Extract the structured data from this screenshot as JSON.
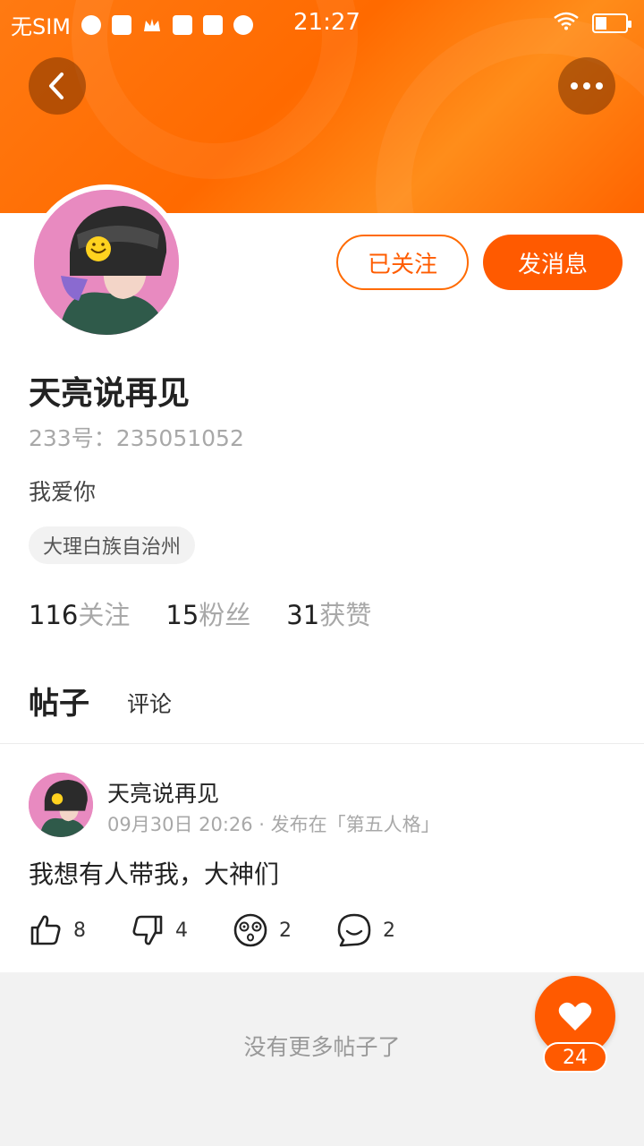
{
  "status_bar": {
    "carrier": "无SIM",
    "time": "21:27",
    "icons": [
      "browser-icon",
      "shop-icon",
      "crown-icon",
      "bag-icon",
      "mail-icon",
      "video-icon"
    ]
  },
  "header": {
    "back_icon": "chevron-left-icon",
    "more_icon": "more-dots-icon",
    "accent_color": "#ff6a00"
  },
  "profile": {
    "follow_label": "已关注",
    "message_label": "发消息",
    "name": "天亮说再见",
    "uid": "233号：235051052",
    "bio": "我爱你",
    "location": "大理白族自治州",
    "stats": [
      {
        "num": "116",
        "label": "关注"
      },
      {
        "num": "15",
        "label": "粉丝"
      },
      {
        "num": "31",
        "label": "获赞"
      }
    ]
  },
  "tabs": {
    "active": "帖子",
    "other": "评论"
  },
  "post": {
    "author": "天亮说再见",
    "meta": "09月30日 20:26 · 发布在「第五人格」",
    "text": "我想有人带我，大神们",
    "actions": [
      {
        "icon": "thumbs-up-icon",
        "count": "8"
      },
      {
        "icon": "thumbs-down-icon",
        "count": "4"
      },
      {
        "icon": "dizzy-face-icon",
        "count": "2"
      },
      {
        "icon": "comment-icon",
        "count": "2"
      }
    ]
  },
  "footer": {
    "no_more": "没有更多帖子了",
    "like_count": "24"
  }
}
